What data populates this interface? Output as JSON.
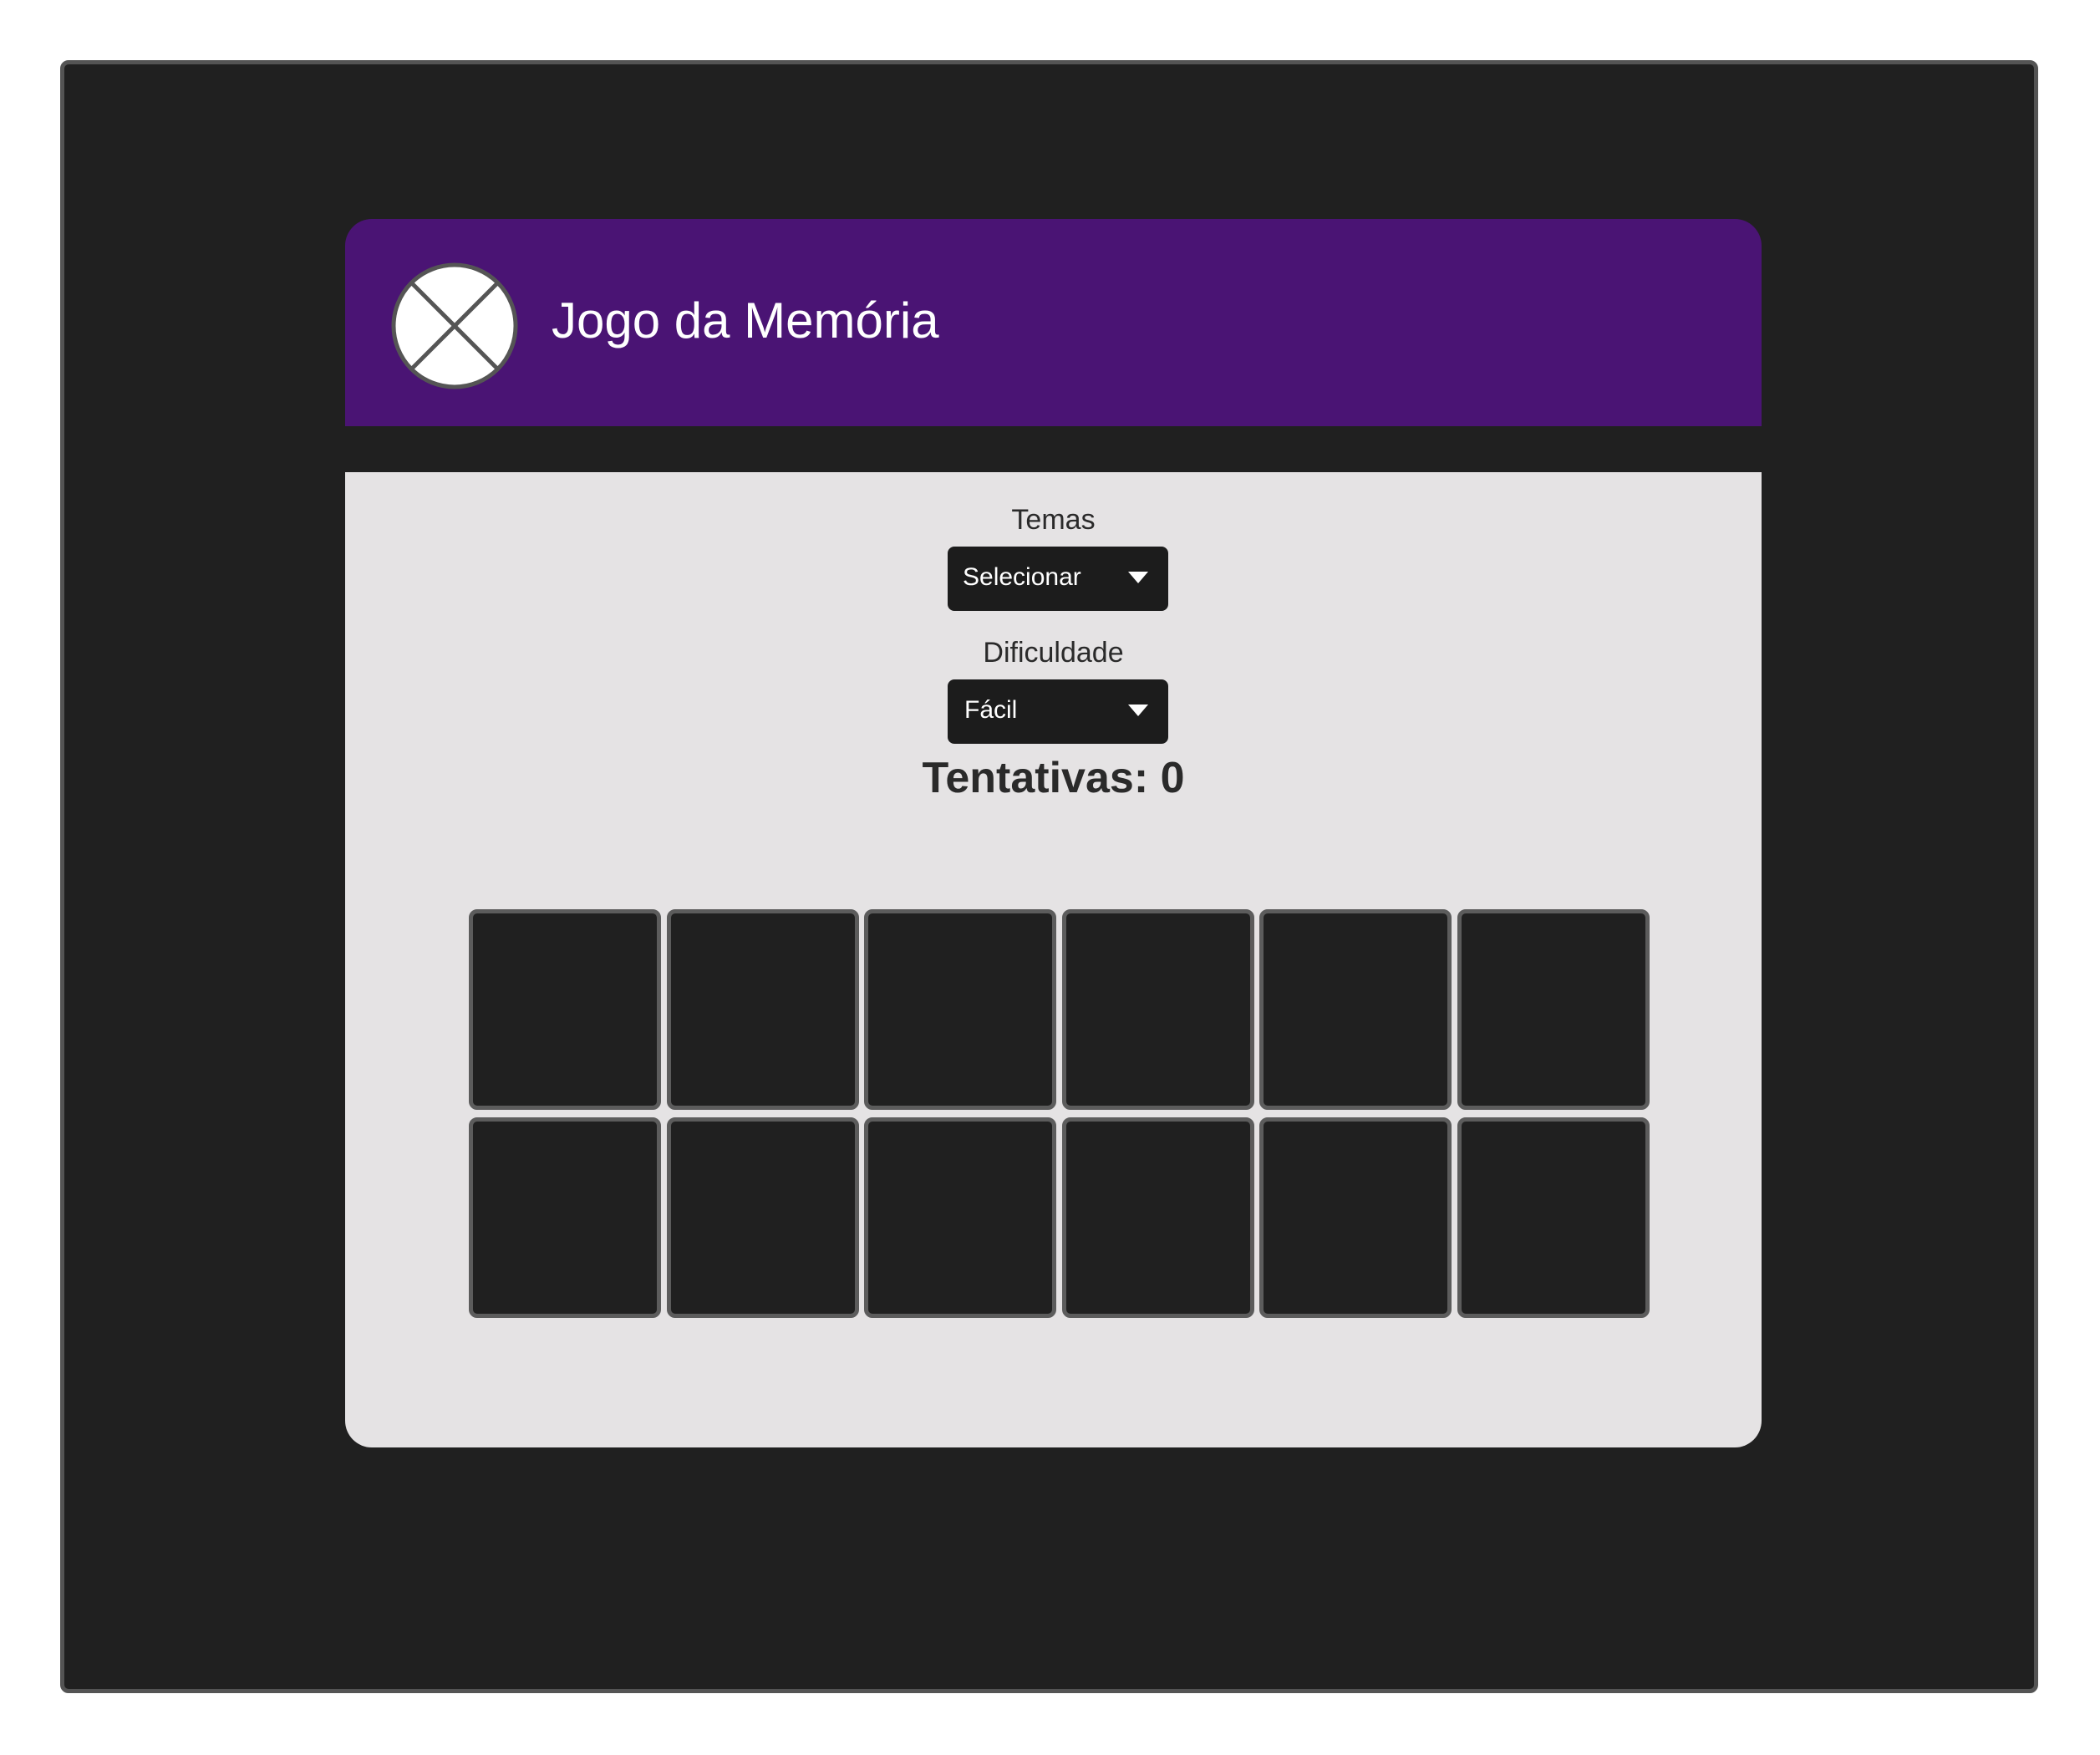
{
  "header": {
    "title": "Jogo da Memória",
    "logo_icon": "x-circle-icon"
  },
  "controls": {
    "theme": {
      "label": "Temas",
      "selected": "Selecionar"
    },
    "difficulty": {
      "label": "Dificuldade",
      "selected": "Fácil"
    }
  },
  "status": {
    "attempts_label": "Tentativas:",
    "attempts_value": "0"
  },
  "board": {
    "rows": 2,
    "columns": 6,
    "cards_face_down": 12
  },
  "colors": {
    "page_background": "#202020",
    "header_background": "#4a1474",
    "body_background": "#e5e3e4",
    "card_back": "#202020",
    "card_border": "#5c5c5c"
  }
}
